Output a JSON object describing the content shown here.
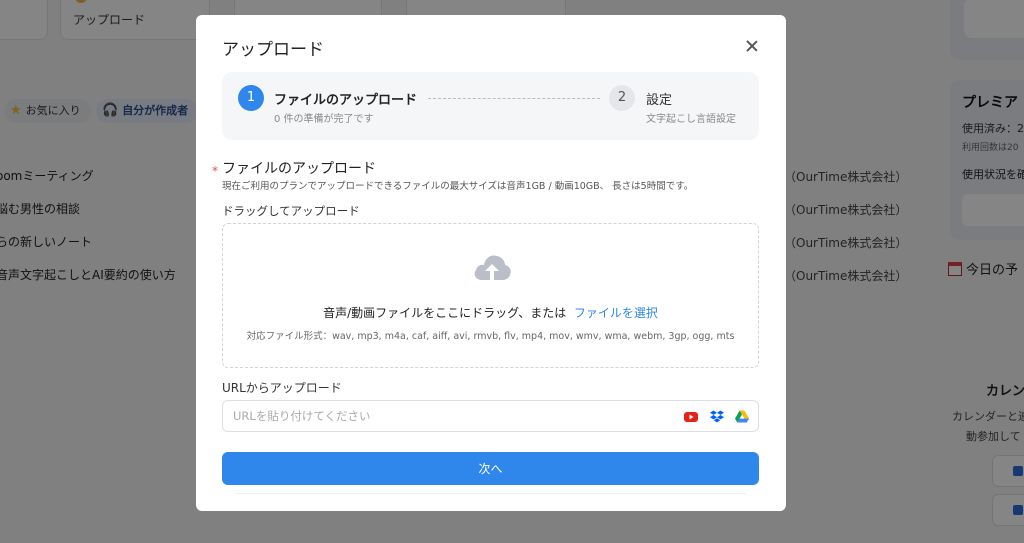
{
  "background": {
    "upload_card_label": "アップロード",
    "chips": [
      {
        "icon": "star-icon",
        "label": "お気に入り"
      },
      {
        "icon": "headset-icon",
        "label": "自分が作成者"
      }
    ],
    "meetings": [
      {
        "title": "oomミーティング",
        "org": "（OurTime株式会社）"
      },
      {
        "title": "悩む男性の相談",
        "org": "（OurTime株式会社）"
      },
      {
        "title": "らの新しいノート",
        "org": "（OurTime株式会社）"
      },
      {
        "title": "音声文字起こしとAI要約の使い方",
        "org": "（OurTime株式会社）"
      }
    ],
    "premium": {
      "title": "プレミア",
      "used": "使用済み：2",
      "limit": "利用回数は20",
      "check": "使用状況を確"
    },
    "today": "今日の予",
    "calendar": {
      "title": "カレン",
      "desc1": "カレンダーと連",
      "desc2": "動参加して"
    }
  },
  "modal": {
    "title": "アップロード",
    "steps": [
      {
        "number": "1",
        "title": "ファイルのアップロード",
        "subtitle": "0 件の準備が完了です"
      },
      {
        "number": "2",
        "title": "設定",
        "subtitle": "文字起こし言語設定"
      }
    ],
    "file_section": {
      "required_mark": "*",
      "title": "ファイルのアップロード",
      "description": "現在ご利用のプランでアップロードできるファイルの最大サイズは音声1GB / 動画10GB、 長さは5時間です。"
    },
    "drag_label": "ドラッグしてアップロード",
    "dropzone": {
      "text": "音声/動画ファイルをここにドラッグ、または",
      "link": "ファイルを選択",
      "formats": "対応ファイル形式：wav, mp3, m4a, caf, aiff, avi, rmvb, flv, mp4, mov, wmv, wma, webm, 3gp, ogg, mts"
    },
    "url_section": {
      "label": "URLからアップロード",
      "placeholder": "URLを貼り付けてください",
      "sources": [
        "youtube-icon",
        "dropbox-icon",
        "google-drive-icon"
      ]
    },
    "next_label": "次へ"
  },
  "colors": {
    "primary": "#2f87ec",
    "required": "#e45050"
  }
}
